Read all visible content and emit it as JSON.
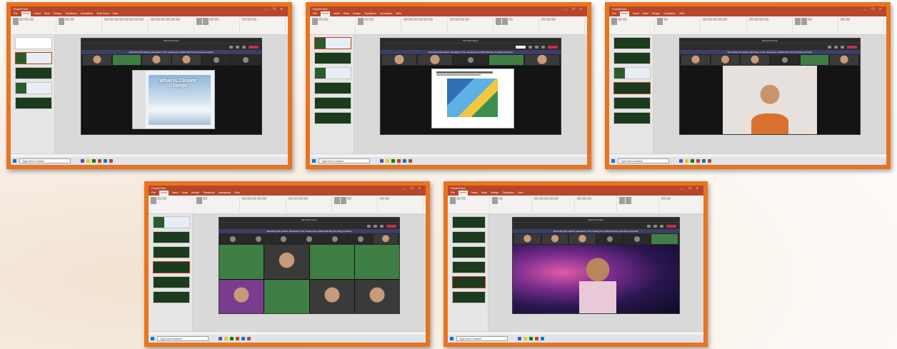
{
  "app": {
    "title_bar": "PowerPoint",
    "window_buttons": "—  ❐  ✕",
    "ribbon_tabs": [
      "File",
      "Home",
      "Insert",
      "Draw",
      "Design",
      "Transitions",
      "Animations",
      "Slide Show",
      "Record",
      "Review",
      "View",
      "Help"
    ],
    "active_tab": "Home",
    "search_placeholder": "Type here to search"
  },
  "teams": {
    "window_title": "Microsoft Teams",
    "notice": "Recording has started. Attendees in the meeting are notified that they are being recorded."
  },
  "colors": {
    "frame": "#e8741f",
    "powerpoint_brand": "#b7472a",
    "teams_leave": "#c4314b",
    "climate_green": "#3f7e44"
  },
  "screenshots": [
    {
      "stage": "slide_share"
    },
    {
      "stage": "story_share"
    },
    {
      "stage": "speaker_boy"
    },
    {
      "stage": "gallery"
    },
    {
      "stage": "speaker_galaxy"
    }
  ],
  "slide_title": "What is Climate Change"
}
